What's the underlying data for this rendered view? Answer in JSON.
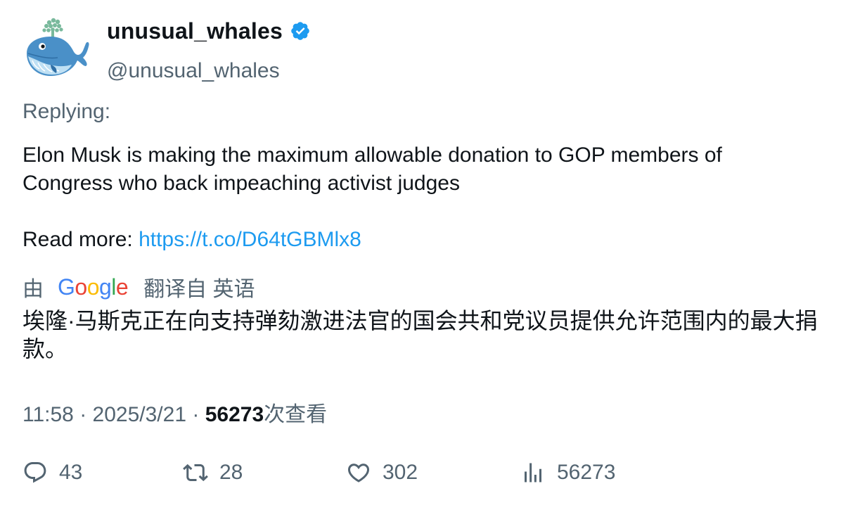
{
  "user": {
    "display_name": "unusual_whales",
    "handle": "@unusual_whales",
    "verified": true,
    "avatar_icon": "whale-icon"
  },
  "tweet": {
    "replying_label": "Replying:",
    "text_line1": "Elon Musk is making the maximum allowable donation to GOP members of Congress who back impeaching activist judges",
    "read_more_label": "Read more: ",
    "link": "https://t.co/D64tGBMlx8"
  },
  "translation": {
    "prefix": "由",
    "provider": "Google",
    "suffix": "翻译自 英语",
    "text": "埃隆·马斯克正在向支持弹劾激进法官的国会共和党议员提供允许范围内的最大捐款。"
  },
  "meta": {
    "time": "11:58",
    "separator": "·",
    "date": "2025/3/21",
    "views": "56273",
    "views_label": "次查看"
  },
  "actions": {
    "replies": "43",
    "retweets": "28",
    "likes": "302",
    "views": "56273"
  },
  "colors": {
    "text_primary": "#0f1419",
    "text_secondary": "#536471",
    "link": "#1d9bf0",
    "verified": "#1d9bf0"
  }
}
